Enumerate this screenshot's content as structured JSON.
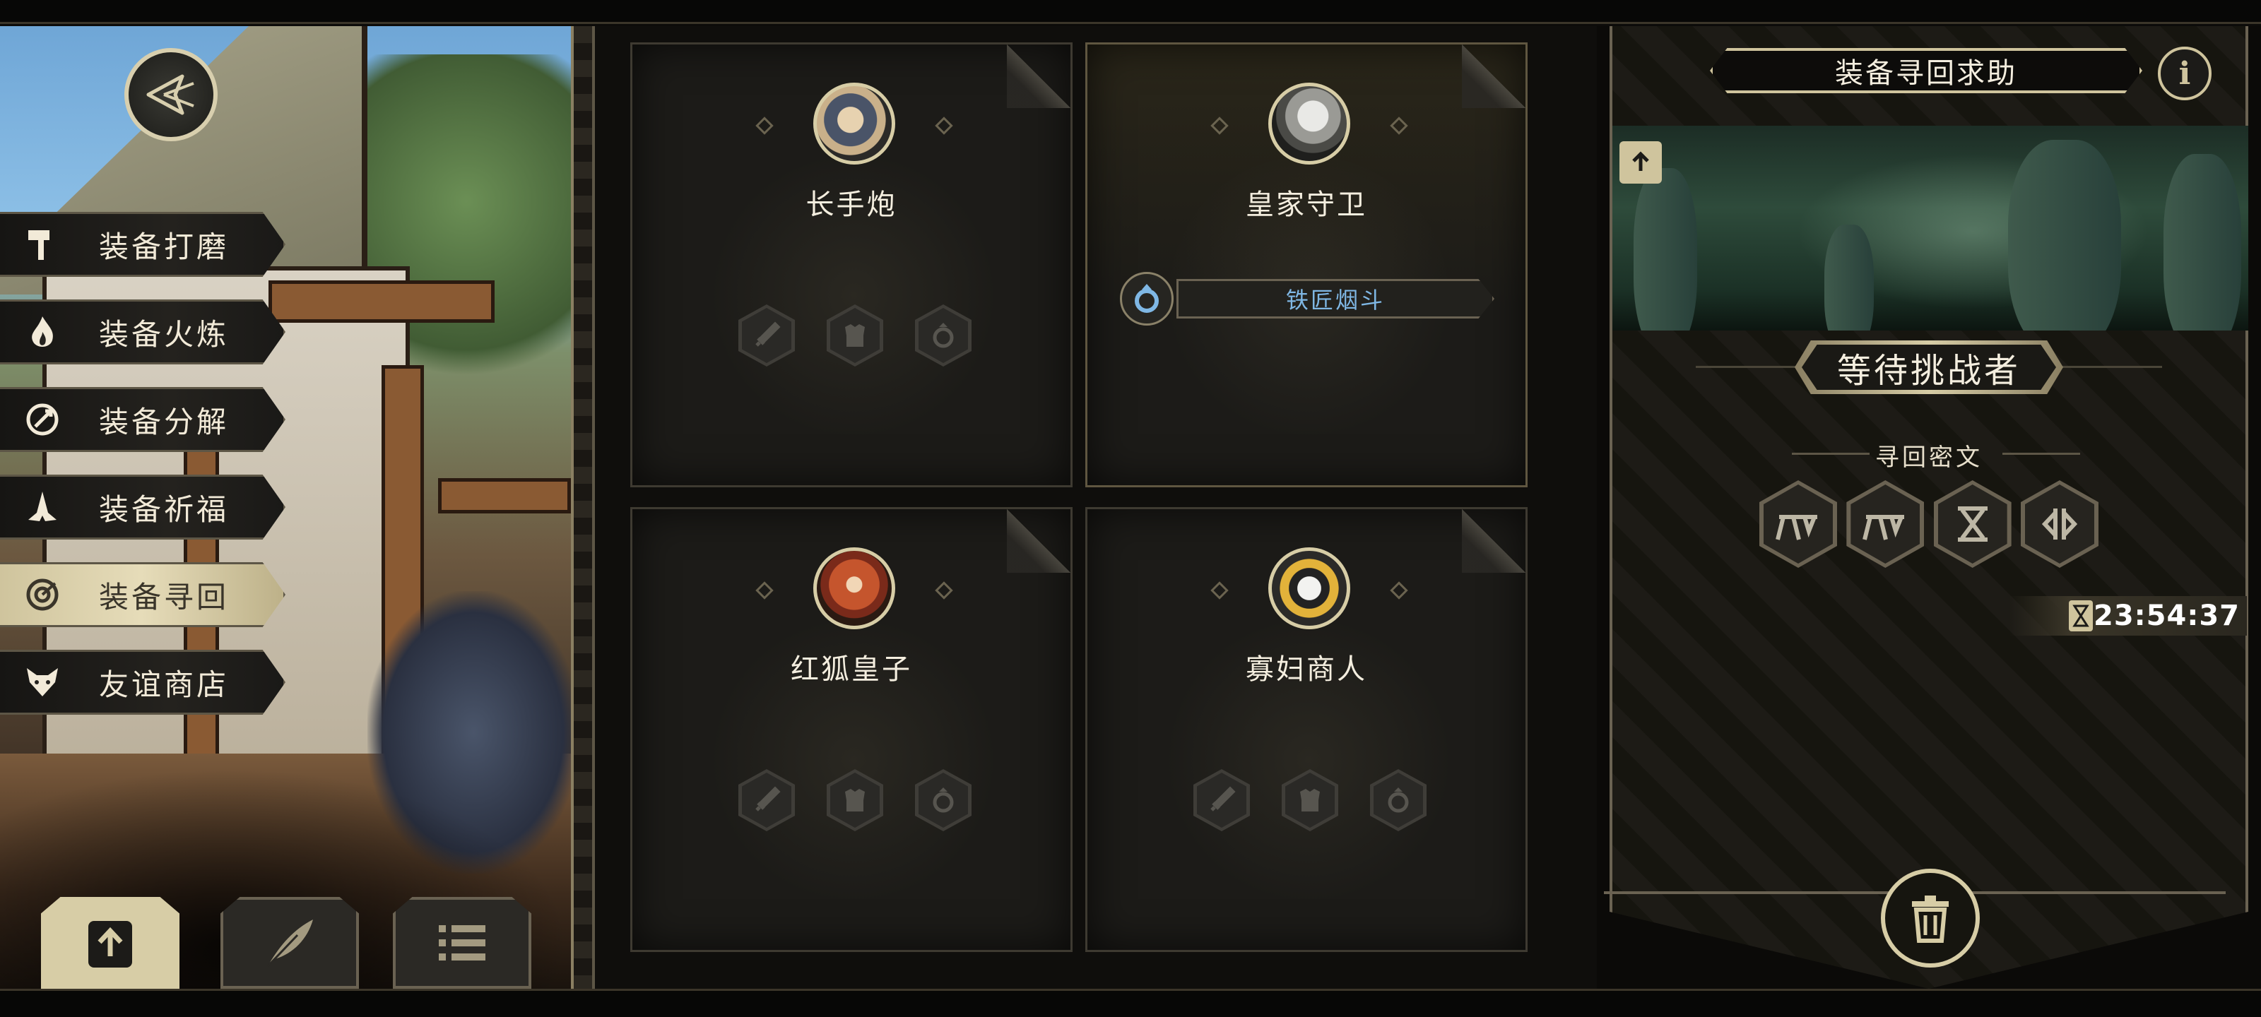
{
  "sidebar": {
    "items": [
      {
        "label": "装备打磨",
        "icon": "hammer-icon",
        "active": false
      },
      {
        "label": "装备火炼",
        "icon": "flame-icon",
        "active": false
      },
      {
        "label": "装备分解",
        "icon": "disassemble-icon",
        "active": false
      },
      {
        "label": "装备祈福",
        "icon": "praying-hands-icon",
        "active": false
      },
      {
        "label": "装备寻回",
        "icon": "retrieve-target-icon",
        "active": true
      },
      {
        "label": "友谊商店",
        "icon": "fox-head-icon",
        "active": false
      }
    ]
  },
  "bottom_buttons": [
    {
      "icon": "share-upload-icon",
      "active": true
    },
    {
      "icon": "quill-feather-icon",
      "active": false
    },
    {
      "icon": "list-icon",
      "active": false
    }
  ],
  "heroes": [
    {
      "name": "长手炮",
      "equipped": null,
      "selected": false
    },
    {
      "name": "皇家守卫",
      "equipped": "铁匠烟斗",
      "selected": true
    },
    {
      "name": "红狐皇子",
      "equipped": null,
      "selected": false
    },
    {
      "name": "寡妇商人",
      "equipped": null,
      "selected": false
    }
  ],
  "panel": {
    "title": "装备寻回求助",
    "info_icon": "i",
    "status": "等待挑战者",
    "cipher_title": "寻回密文",
    "runes": [
      "rune-1-icon",
      "rune-2-icon",
      "rune-3-icon",
      "rune-4-icon"
    ],
    "timer": "23:54:37"
  },
  "colors": {
    "accent": "#d7cda6",
    "equip_text": "#7fb7e4",
    "background": "#0c0b09"
  }
}
